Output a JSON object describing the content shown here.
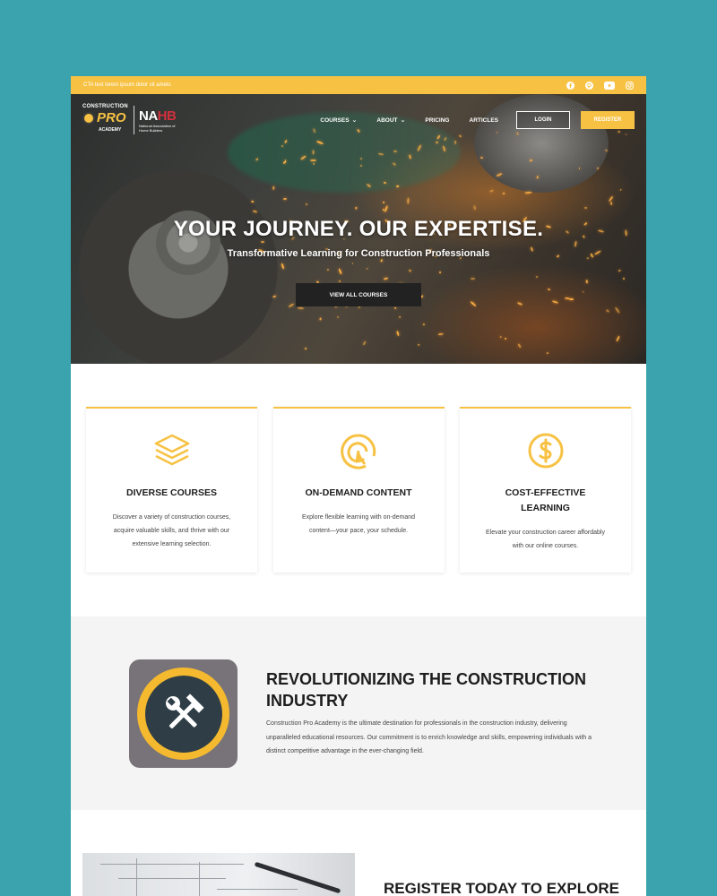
{
  "topbar": {
    "cta_text": "CTA text lorem ipsum dolor sit amets",
    "socials": [
      "facebook-icon",
      "pinterest-icon",
      "youtube-icon",
      "instagram-icon"
    ]
  },
  "header": {
    "logo": {
      "line1": "CONSTRUCTION",
      "line2": "PRO",
      "line3": "ACADEMY",
      "partner_mark_a": "NA",
      "partner_mark_b": "HB",
      "partner_sub": "National Association of Home Builders"
    },
    "nav": {
      "courses": "COURSES",
      "about": "ABOUT",
      "pricing": "PRICING",
      "articles": "ARTICLES"
    },
    "login": "LOGIN",
    "register": "REGISTER"
  },
  "hero": {
    "title": "YOUR JOURNEY. OUR EXPERTISE.",
    "subtitle": "Transformative Learning for Construction Professionals",
    "button": "VIEW ALL COURSES"
  },
  "features": [
    {
      "icon": "layers-icon",
      "title": "DIVERSE COURSES",
      "text": "Discover a variety of construction courses, acquire valuable skills, and thrive with our extensive learning selection."
    },
    {
      "icon": "target-cursor-icon",
      "title": "ON-DEMAND CONTENT",
      "text": "Explore flexible learning with on-demand content—your pace, your schedule."
    },
    {
      "icon": "dollar-icon",
      "title": "COST-EFFECTIVE LEARNING",
      "text": "Elevate your construction career affordably with our online courses."
    }
  ],
  "about": {
    "icon": "hammer-wrench-icon",
    "title": "REVOLUTIONIZING THE CONSTRUCTION INDUSTRY",
    "text": "Construction Pro Academy is the ultimate destination for professionals in the construction industry, delivering unparalleled educational resources. Our commitment is to enrich knowledge and skills, empowering individuals with a distinct competitive advantage in the ever-changing field."
  },
  "bottom": {
    "heading": "REGISTER TODAY TO EXPLORE"
  },
  "colors": {
    "accent": "#f7c244",
    "background": "#3aa3ad",
    "dark": "#1d1d1d"
  }
}
